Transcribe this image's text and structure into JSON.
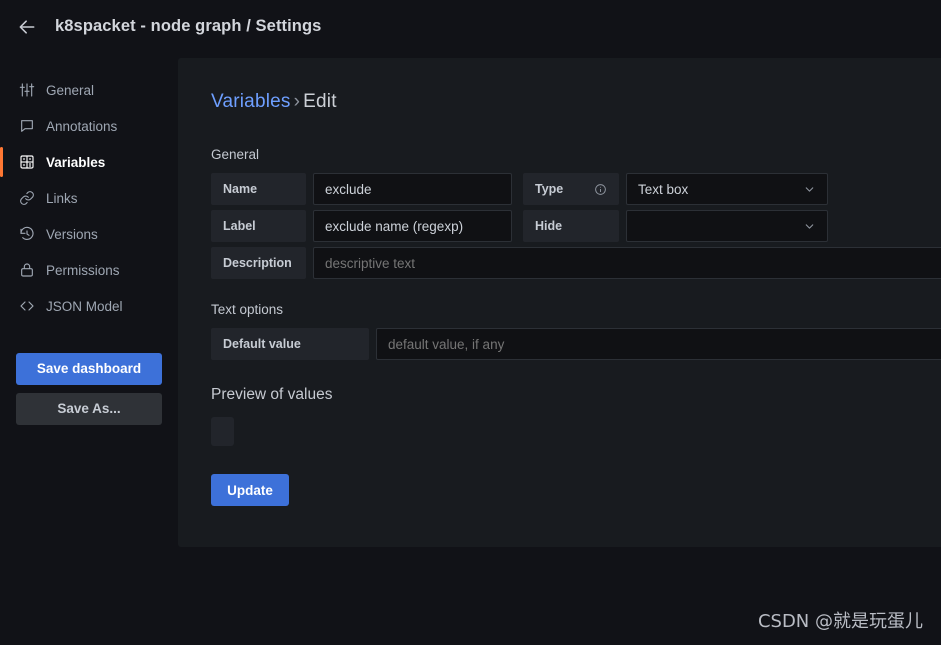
{
  "header": {
    "back_icon": "arrow-left-icon",
    "title": "k8spacket - node graph / Settings"
  },
  "sidebar": {
    "items": [
      {
        "label": "General",
        "icon": "sliders-icon",
        "active": false
      },
      {
        "label": "Annotations",
        "icon": "comment-icon",
        "active": false
      },
      {
        "label": "Variables",
        "icon": "calculator-icon",
        "active": true
      },
      {
        "label": "Links",
        "icon": "link-icon",
        "active": false
      },
      {
        "label": "Versions",
        "icon": "history-icon",
        "active": false
      },
      {
        "label": "Permissions",
        "icon": "lock-icon",
        "active": false
      },
      {
        "label": "JSON Model",
        "icon": "code-icon",
        "active": false
      }
    ],
    "save_dashboard_label": "Save dashboard",
    "save_as_label": "Save As..."
  },
  "content": {
    "breadcrumb": {
      "parent": "Variables",
      "separator": "›",
      "current": "Edit"
    },
    "general": {
      "section_title": "General",
      "name": {
        "label": "Name",
        "value": "exclude",
        "placeholder": ""
      },
      "type": {
        "label": "Type",
        "info_icon": "info-circle-icon",
        "value": "Text box",
        "chevron": "chevron-down-icon"
      },
      "variable_label": {
        "label": "Label",
        "value": "exclude name (regexp)",
        "placeholder": ""
      },
      "hide": {
        "label": "Hide",
        "value": "",
        "chevron": "chevron-down-icon"
      },
      "description": {
        "label": "Description",
        "value": "",
        "placeholder": "descriptive text"
      }
    },
    "text_options": {
      "section_title": "Text options",
      "default_value": {
        "label": "Default value",
        "value": "",
        "placeholder": "default value, if any"
      }
    },
    "preview": {
      "title": "Preview of values",
      "values": []
    },
    "update_label": "Update"
  },
  "watermark": "CSDN @就是玩蛋儿",
  "colors": {
    "accent_active": "#ff7733",
    "primary_button": "#3d71d9",
    "panel_bg": "#181b1f",
    "app_bg": "#111217",
    "link": "#6e9fff"
  }
}
